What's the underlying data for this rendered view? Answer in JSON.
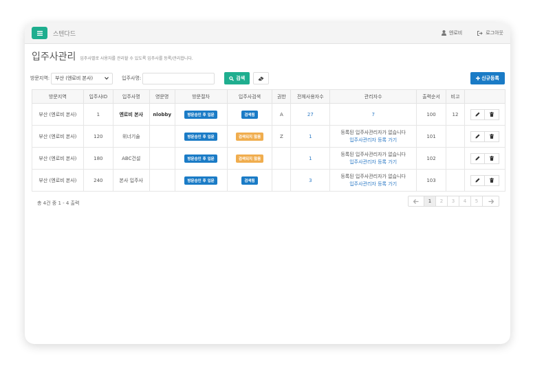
{
  "topbar": {
    "brand": "스텐다드",
    "user": "엔로비",
    "logout": "로그아웃"
  },
  "header": {
    "title": "입주사관리",
    "description": "입주사별로 사용자를 관리할 수 있도록 입주사를 등록/관리합니다."
  },
  "filters": {
    "region_label": "방문지역:",
    "region_value": "부산 (엔로비 본사)",
    "tenant_label": "입주사명:",
    "tenant_value": "",
    "search_label": "검색",
    "new_label": "신규등록"
  },
  "table": {
    "columns": [
      "방문지역",
      "입주사ID",
      "입주사명",
      "영문명",
      "방문절차",
      "입주사검색",
      "권한",
      "전체사용자수",
      "관리자수",
      "출력순서",
      "비고",
      ""
    ],
    "rows": [
      {
        "region": "부산 (엔로비 본사)",
        "id": "1",
        "name": "엔로비 본사",
        "eng": "nlobby",
        "procedure": "방문승인 후 입문",
        "search": "검색됨",
        "auth": "A",
        "users": "27",
        "admins": "7",
        "admin_msg": "",
        "admin_link": "",
        "order": "100",
        "note": "12"
      },
      {
        "region": "부산 (엔로비 본사)",
        "id": "120",
        "name": "위너기술",
        "eng": "",
        "procedure": "방문승인 후 입문",
        "search": "검색되지 않음",
        "auth": "Z",
        "users": "1",
        "admins": "",
        "admin_msg": "등록된 입주사관리자가 없습니다",
        "admin_link": "입주사관리자 등록 가기",
        "order": "101",
        "note": ""
      },
      {
        "region": "부산 (엔로비 본사)",
        "id": "180",
        "name": "ABC건설",
        "eng": "",
        "procedure": "방문승인 후 입문",
        "search": "검색되지 않음",
        "auth": "",
        "users": "1",
        "admins": "",
        "admin_msg": "등록된 입주사관리자가 없습니다",
        "admin_link": "입주사관리자 등록 가기",
        "order": "102",
        "note": ""
      },
      {
        "region": "부산 (엔로비 본사)",
        "id": "240",
        "name": "본사 입주사",
        "eng": "",
        "procedure": "방문승인 후 입문",
        "search": "검색됨",
        "auth": "",
        "users": "3",
        "admins": "",
        "admin_msg": "등록된 입주사관리자가 없습니다",
        "admin_link": "입주사관리자 등록 가기",
        "order": "103",
        "note": ""
      }
    ]
  },
  "footer": {
    "summary": "총 4건 중 1 - 4 출력"
  },
  "pager": {
    "pages": [
      "1",
      "2",
      "3",
      "4",
      "5"
    ],
    "current": "1"
  },
  "colors": {
    "teal": "#1fae8f",
    "blue": "#1a7bc6",
    "orange": "#f0ad4e",
    "link": "#2b79c5"
  },
  "icons": [
    "menu-icon",
    "user-icon",
    "logout-icon",
    "search-icon",
    "eraser-icon",
    "plus-icon",
    "pencil-icon",
    "trash-icon",
    "chevron-down-icon",
    "arrow-left-icon",
    "arrow-right-icon"
  ]
}
